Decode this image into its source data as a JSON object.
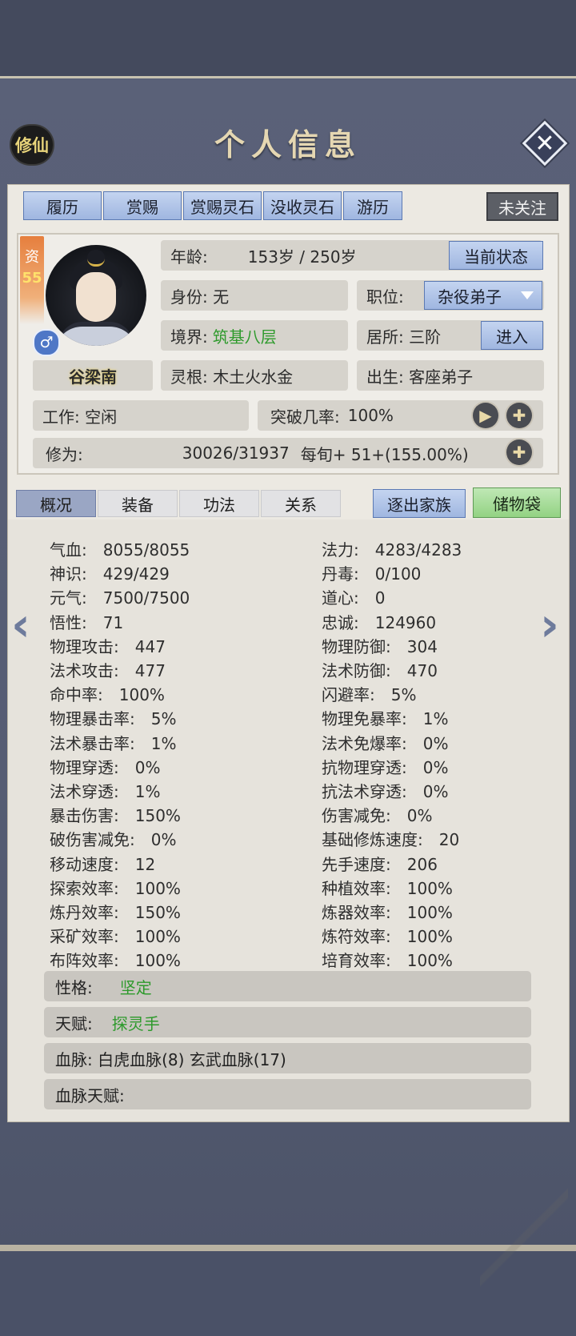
{
  "header": {
    "sect_badge": "修仙",
    "title": "个人信息",
    "close_symbol": "✕"
  },
  "top_tabs": [
    "履历",
    "赏赐",
    "赏赐灵石",
    "没收灵石",
    "游历"
  ],
  "follow_label": "未关注",
  "profile": {
    "aptitude_label": "资",
    "aptitude_value": "55",
    "gender_symbol": "♂",
    "name": "谷梁南",
    "age_label": "年龄:",
    "age_value": "153岁 / 250岁",
    "status_button": "当前状态",
    "identity": "身份:  无",
    "position_label": "职位:",
    "position_value": "杂役弟子",
    "realm_label": "境界:",
    "realm_value": "筑基八层",
    "residence": "居所: 三阶",
    "enter_button": "进入",
    "spirit_root": "灵根:  木土火水金",
    "birth": "出生:  客座弟子",
    "work": "工作: 空闲",
    "breakthrough_label": "突破几率:",
    "breakthrough_value": "100%",
    "cultivation_label": "修为:",
    "cultivation_value": "30026/31937",
    "per_period": "每旬+  51+(155.00%)"
  },
  "mid_tabs": [
    "概况",
    "装备",
    "功法",
    "关系"
  ],
  "expel_button": "逐出家族",
  "storage_button": "储物袋",
  "stats_left": [
    [
      "气血:",
      "8055/8055"
    ],
    [
      "神识:",
      "429/429"
    ],
    [
      "元气:",
      "7500/7500"
    ],
    [
      "悟性:",
      "71"
    ],
    [
      "物理攻击:",
      "447"
    ],
    [
      "法术攻击:",
      "477"
    ],
    [
      "命中率:",
      "100%"
    ],
    [
      "物理暴击率:",
      "5%"
    ],
    [
      "法术暴击率:",
      "1%"
    ],
    [
      "物理穿透:",
      "0%"
    ],
    [
      "法术穿透:",
      "1%"
    ],
    [
      "暴击伤害:",
      "150%"
    ],
    [
      "破伤害减免:",
      "0%"
    ],
    [
      "移动速度:",
      "12"
    ],
    [
      "探索效率:",
      "100%"
    ],
    [
      "炼丹效率:",
      "150%"
    ],
    [
      "采矿效率:",
      "100%"
    ],
    [
      "布阵效率:",
      "100%"
    ]
  ],
  "stats_right": [
    [
      "法力:",
      "4283/4283"
    ],
    [
      "丹毒:",
      "0/100"
    ],
    [
      "道心:",
      "0"
    ],
    [
      "忠诚:",
      "124960"
    ],
    [
      "物理防御:",
      "304"
    ],
    [
      "法术防御:",
      "470"
    ],
    [
      "闪避率:",
      "5%"
    ],
    [
      "物理免暴率:",
      "1%"
    ],
    [
      "法术免爆率:",
      "0%"
    ],
    [
      "抗物理穿透:",
      "0%"
    ],
    [
      "抗法术穿透:",
      "0%"
    ],
    [
      "伤害减免:",
      "0%"
    ],
    [
      "基础修炼速度:",
      "20"
    ],
    [
      "先手速度:",
      "206"
    ],
    [
      "种植效率:",
      "100%"
    ],
    [
      "炼器效率:",
      "100%"
    ],
    [
      "炼符效率:",
      "100%"
    ],
    [
      "培育效率:",
      "100%"
    ]
  ],
  "traits": {
    "personality_label": "性格:",
    "personality_value": "坚定",
    "talent_label": "天赋:",
    "talent_value": "探灵手",
    "bloodline": "血脉: 白虎血脉(8)    玄武血脉(17)",
    "bloodline_talent": "血脉天赋:"
  },
  "colors": {
    "green": "#2e9a2c",
    "tab_blue": "#9fb6e0",
    "panel": "#ece9e2"
  }
}
